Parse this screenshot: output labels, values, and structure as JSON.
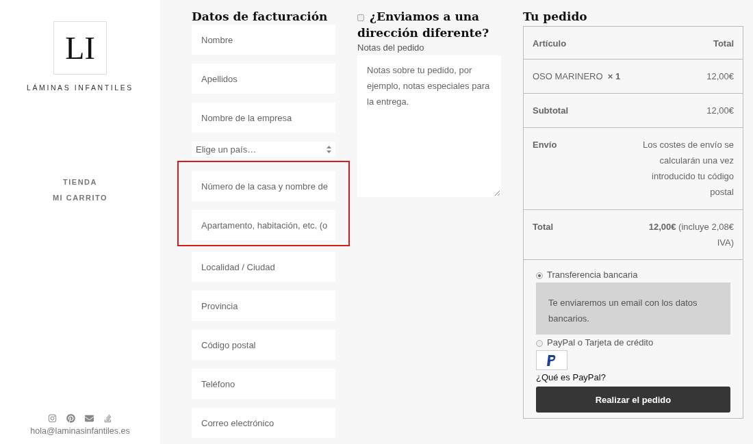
{
  "sidebar": {
    "logo": "LI",
    "brand": "LÁMINAS INFANTILES",
    "nav": [
      {
        "label": "TIENDA"
      },
      {
        "label": "MI CARRITO"
      }
    ],
    "social": [
      {
        "kind": "instagram"
      },
      {
        "kind": "pinterest"
      },
      {
        "kind": "mail"
      },
      {
        "kind": "stack"
      }
    ],
    "email": "hola@laminasinfantiles.es"
  },
  "billing": {
    "title": "Datos de facturación",
    "fields": [
      {
        "kind": "input",
        "placeholder": "Nombre",
        "highlighted": false
      },
      {
        "kind": "input",
        "placeholder": "Apellidos",
        "highlighted": false
      },
      {
        "kind": "input",
        "placeholder": "Nombre de la empresa",
        "highlighted": false
      },
      {
        "kind": "select",
        "value": "Elige un país…",
        "highlighted": false
      },
      {
        "kind": "input",
        "placeholder": "Número de la casa y nombre de",
        "highlighted": true
      },
      {
        "kind": "input",
        "placeholder": "Apartamento, habitación, etc. (o",
        "highlighted": true
      },
      {
        "kind": "input",
        "placeholder": "Localidad / Ciudad",
        "highlighted": false
      },
      {
        "kind": "input",
        "placeholder": "Provincia",
        "highlighted": false
      },
      {
        "kind": "input",
        "placeholder": "Código postal",
        "highlighted": false
      },
      {
        "kind": "input",
        "placeholder": "Teléfono",
        "highlighted": false
      },
      {
        "kind": "input",
        "placeholder": "Correo electrónico",
        "highlighted": false
      }
    ]
  },
  "shipping": {
    "checked": false,
    "title": "¿Enviamos a una dirección diferente?",
    "notes_label": "Notas del pedido",
    "notes_placeholder": "Notas sobre tu pedido, por ejemplo, notas especiales para la entrega."
  },
  "order": {
    "title": "Tu pedido",
    "columns": [
      "Artículo",
      "Total"
    ],
    "rows": [
      {
        "kind": "item",
        "label": "OSO MARINERO",
        "qty": "× 1",
        "value": "12,00€"
      },
      {
        "kind": "total",
        "label": "Subtotal",
        "value": "12,00€"
      },
      {
        "kind": "total",
        "label": "Envío",
        "value": "Los costes de envío se calcularán una vez introducido tu código postal"
      },
      {
        "kind": "total",
        "label": "Total",
        "value": "**12,00€** (incluye 2,08€ IVA)"
      }
    ],
    "payments": [
      {
        "label": "Transferencia bancaria",
        "selected": true,
        "description": "Te enviaremos un email con los datos bancarios."
      },
      {
        "label": "PayPal o Tarjeta de crédito",
        "selected": false,
        "link": "¿Qué es PayPal?"
      }
    ],
    "button": "Realizar el pedido"
  }
}
